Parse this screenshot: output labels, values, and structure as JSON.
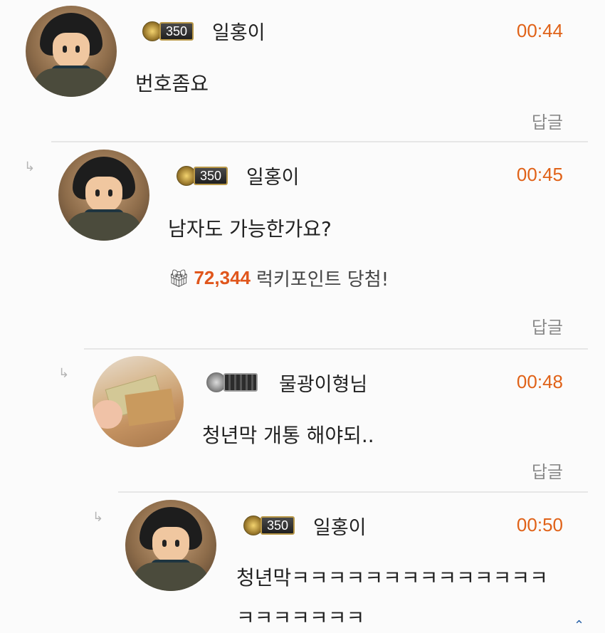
{
  "comments": [
    {
      "level_badge": "350",
      "nickname": "일홍이",
      "time": "00:44",
      "text": "번호좀요",
      "reply_label": "답글"
    },
    {
      "level_badge": "350",
      "nickname": "일홍이",
      "time": "00:45",
      "text": "남자도 가능한가요?",
      "lucky": {
        "points": "72,344",
        "label": "럭키포인트 당첨!"
      },
      "reply_label": "답글"
    },
    {
      "level_badge": "",
      "nickname": "물광이형님",
      "time": "00:48",
      "text": "청년막 개통 해야되..",
      "reply_label": "답글"
    },
    {
      "level_badge": "350",
      "nickname": "일홍이",
      "time": "00:50",
      "text_line1": "청년막ㅋㅋㅋㅋㅋㅋㅋㅋㅋㅋㅋㅋㅋㅋ",
      "text_line2": "ㅋㅋㅋㅋㅋㅋㅋ"
    }
  ],
  "icons": {
    "reply_arrow": "reply-arrow-icon",
    "gift": "gift-icon"
  },
  "colors": {
    "time": "#e06218",
    "points": "#e0561c",
    "reply": "#8a8a8a"
  }
}
